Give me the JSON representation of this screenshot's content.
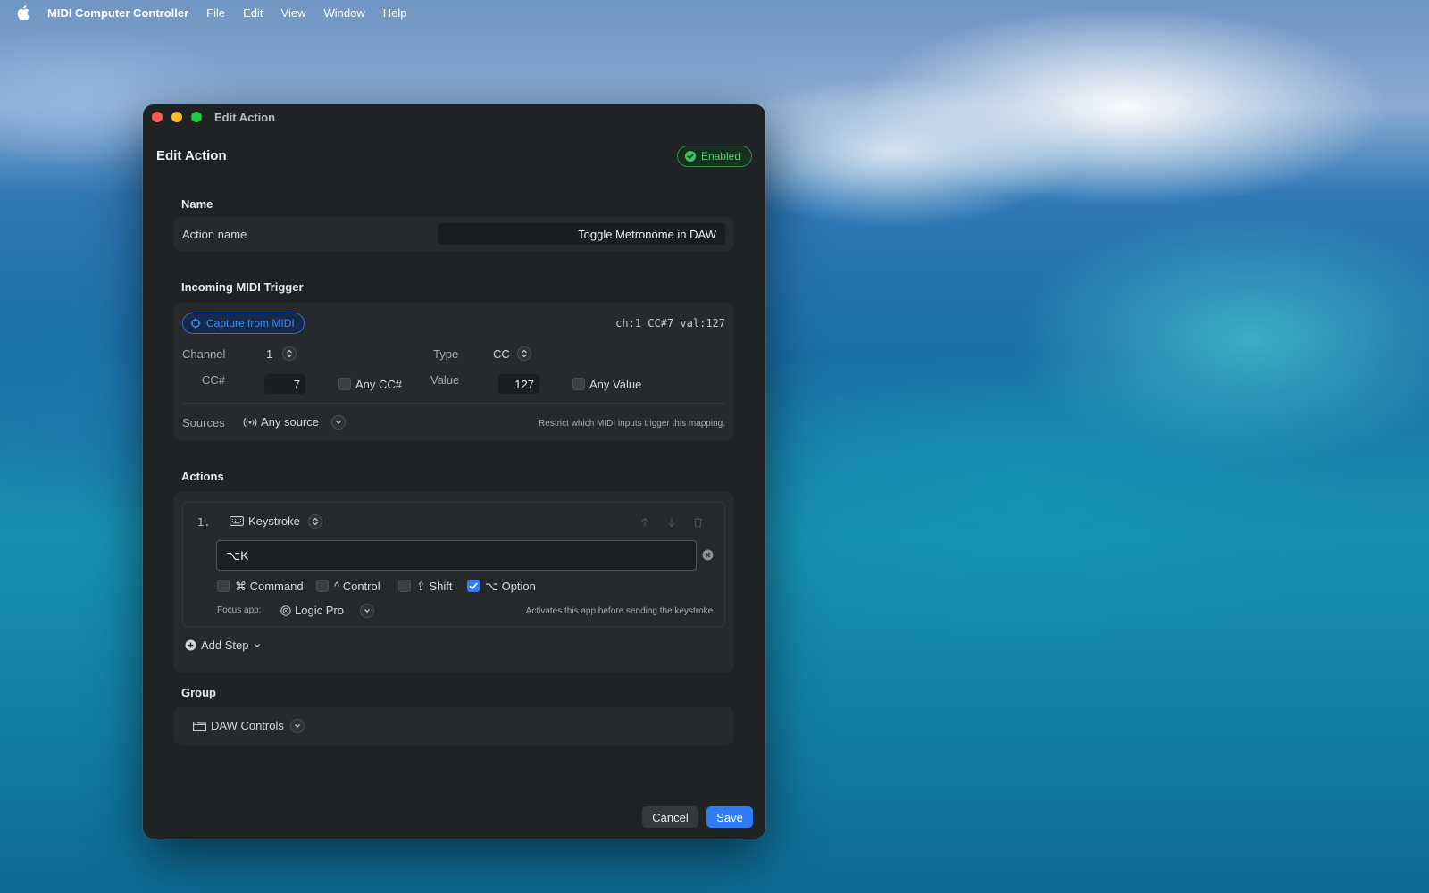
{
  "menubar": {
    "app_name": "MIDI Computer Controller",
    "menus": [
      "File",
      "Edit",
      "View",
      "Window",
      "Help"
    ]
  },
  "window": {
    "title": "Edit Action",
    "header_title": "Edit Action",
    "status_badge": "Enabled"
  },
  "name_section": {
    "label": "Name",
    "field_label": "Action name",
    "field_value": "Toggle Metronome in DAW"
  },
  "trigger": {
    "label": "Incoming MIDI Trigger",
    "capture_button": "Capture from MIDI",
    "readout": "ch:1 CC#7 val:127",
    "channel_label": "Channel",
    "channel_value": "1",
    "type_label": "Type",
    "type_value": "CC",
    "cc_label": "CC#",
    "cc_value": "7",
    "any_cc_label": "Any CC#",
    "value_label": "Value",
    "value_value": "127",
    "any_value_label": "Any Value",
    "sources_label": "Sources",
    "sources_value": "Any source",
    "sources_hint": "Restrict which MIDI inputs trigger this mapping."
  },
  "actions": {
    "label": "Actions",
    "steps": [
      {
        "index": "1.",
        "type": "Keystroke",
        "keystroke": "⌥K",
        "modifiers": {
          "command": {
            "label": "⌘ Command",
            "checked": false
          },
          "control": {
            "label": "^ Control",
            "checked": false
          },
          "shift": {
            "label": "⇧ Shift",
            "checked": false
          },
          "option": {
            "label": "⌥ Option",
            "checked": true
          }
        },
        "focus_app_label": "Focus app:",
        "focus_app_value": "Logic Pro",
        "focus_app_hint": "Activates this app before sending the keystroke."
      }
    ],
    "add_step": "Add Step"
  },
  "group": {
    "label": "Group",
    "value": "DAW Controls"
  },
  "footer": {
    "cancel": "Cancel",
    "save": "Save"
  },
  "colors": {
    "accent": "#2f7cf6",
    "enabled_green": "#4fd17a",
    "close": "#ff5f57",
    "minimize": "#febc2e",
    "maximize": "#28c840"
  }
}
